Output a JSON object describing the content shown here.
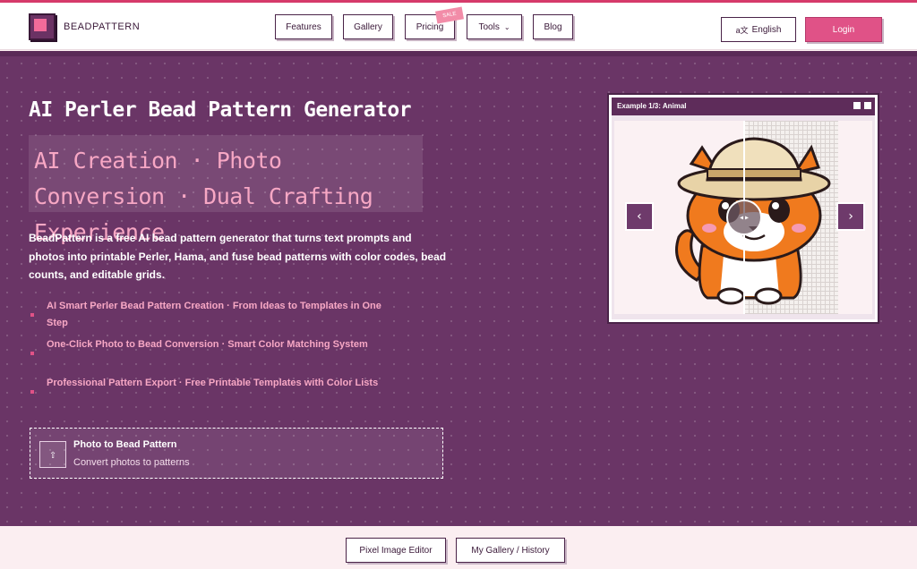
{
  "header": {
    "brand": "BEADPATTERN",
    "nav": [
      "Features",
      "Gallery",
      "Pricing",
      "Tools",
      "Blog"
    ],
    "sale_badge": "SALE",
    "language": "English",
    "login": "Login"
  },
  "hero": {
    "title": "AI Perler Bead Pattern Generator",
    "tagline": "AI Creation · Photo Conversion · Dual Crafting Experience",
    "description": "BeadPattern is a free AI bead pattern generator that turns text prompts and photos into printable Perler, Hama, and fuse bead patterns with color codes, bead counts, and editable grids.",
    "features": [
      "AI Smart Perler Bead Pattern Creation · From Ideas to Templates in One Step",
      "One-Click Photo to Bead Conversion · Smart Color Matching System",
      "Professional Pattern Export · Free Printable Templates with Color Lists"
    ],
    "upload": {
      "title": "Photo to Bead Pattern",
      "subtitle": "Convert photos to patterns"
    }
  },
  "example": {
    "title": "Example 1/3: Animal",
    "prev_icon": "chevron-left-icon",
    "next_icon": "chevron-right-icon"
  },
  "bottom": {
    "buttons": [
      "Pixel Image Editor",
      "My Gallery / History"
    ]
  },
  "colors": {
    "hero_bg": "#6a3566",
    "accent_pink": "#e05287",
    "tagline_pink": "#f7a7c4"
  }
}
